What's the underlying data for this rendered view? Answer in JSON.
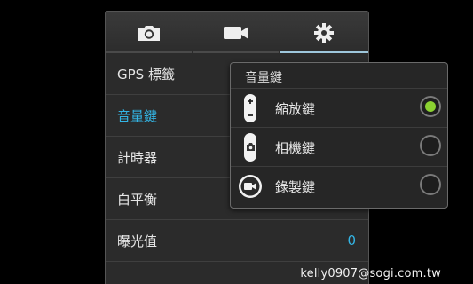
{
  "tabs": [
    {
      "icon": "camera-icon"
    },
    {
      "icon": "video-camera-icon"
    },
    {
      "icon": "gear-icon",
      "selected": true
    }
  ],
  "settings": [
    {
      "label": "GPS 標籤",
      "value": ""
    },
    {
      "label": "音量鍵",
      "value": "",
      "active": true
    },
    {
      "label": "計時器",
      "value": ""
    },
    {
      "label": "白平衡",
      "value": ""
    },
    {
      "label": "曝光值",
      "value": "0"
    }
  ],
  "popup": {
    "title": "音量鍵",
    "options": [
      {
        "label": "縮放鍵",
        "icon": "zoom-key-icon",
        "selected": true
      },
      {
        "label": "相機鍵",
        "icon": "camera-key-icon",
        "selected": false
      },
      {
        "label": "錄製鍵",
        "icon": "record-key-icon",
        "selected": false
      }
    ]
  },
  "colors": {
    "accent": "#33b5e5",
    "radio_selected": "#8bd131",
    "tab_underline": "#9ec7dc"
  },
  "watermark": "kelly0907@sogi.com.tw"
}
